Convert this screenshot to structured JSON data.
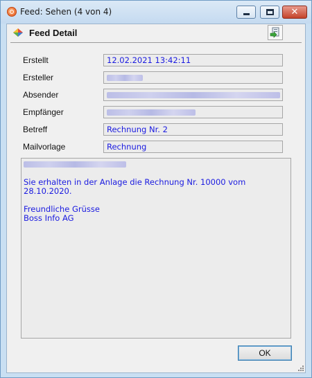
{
  "window": {
    "title": "Feed: Sehen (4 von 4)",
    "close_glyph": "✕"
  },
  "header": {
    "title": "Feed Detail"
  },
  "fields": [
    {
      "label": "Erstellt",
      "value": "12.02.2021 13:42:11"
    },
    {
      "label": "Ersteller",
      "value": ""
    },
    {
      "label": "Absender",
      "value": ""
    },
    {
      "label": "Empfänger",
      "value": ""
    },
    {
      "label": "Betreff",
      "value": "Rechnung Nr. 2"
    },
    {
      "label": "Mailvorlage",
      "value": "Rechnung"
    }
  ],
  "message": {
    "line1": "Sie erhalten in der Anlage die Rechnung Nr. 10000 vom",
    "line2": "28.10.2020.",
    "closing": "Freundliche Grüsse",
    "signature": "Boss Info AG"
  },
  "buttons": {
    "ok": "OK"
  }
}
